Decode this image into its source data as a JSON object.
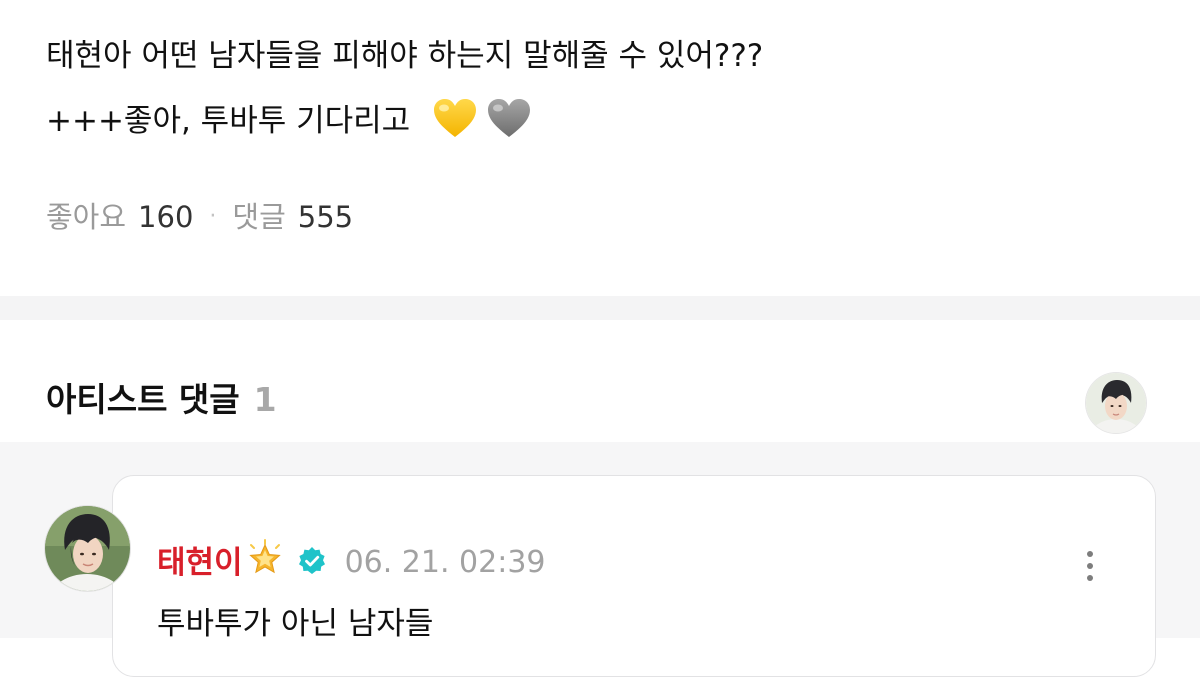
{
  "post": {
    "line1": "태현아 어떤 남자들을 피해야 하는지 말해줄 수 있어???",
    "line2": "+++좋아, 투바투 기다리고",
    "hearts": [
      "yellow-heart",
      "grey-heart"
    ],
    "likes_label": "좋아요",
    "likes_count": "160",
    "separator": "·",
    "comments_label": "댓글",
    "comments_count": "555"
  },
  "artist_section": {
    "title": "아티스트 댓글",
    "count": "1"
  },
  "comment": {
    "author": "태현이",
    "badge_icons": [
      "glowing-star",
      "verified-badge"
    ],
    "timestamp": "06. 21. 02:39",
    "text": "투바투가 아닌 남자들",
    "more_icon": "kebab-vertical"
  },
  "colors": {
    "author_red": "#d81f2a",
    "verified_teal": "#1fc3c9",
    "muted_gray": "#9a9a9a",
    "divider_gray": "#f4f4f5"
  }
}
